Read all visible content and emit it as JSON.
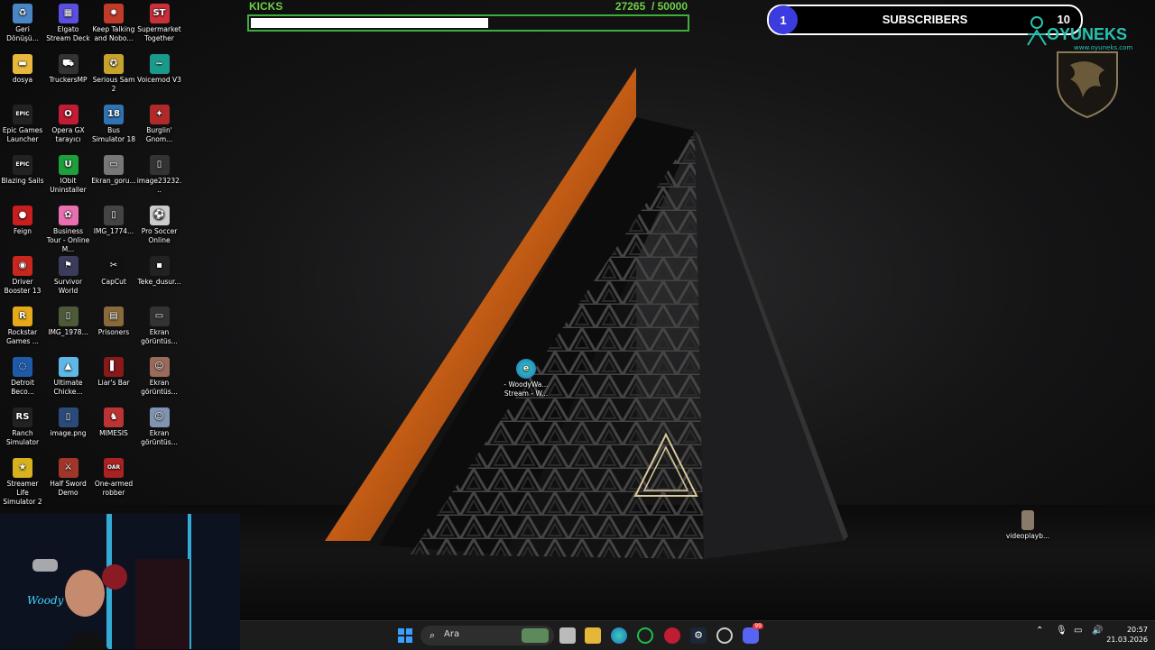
{
  "kicks": {
    "title": "KICKS",
    "current": "27265",
    "goal": "/ 50000",
    "progress": 0.545
  },
  "subscribers": {
    "current": "1",
    "label": "SUBSCRIBERS",
    "goal": "10"
  },
  "brand": {
    "name": "OYUNEKS",
    "url": "www.oyuneks.com"
  },
  "desktop_icons": [
    {
      "label": "Geri Dönüşü...",
      "color": "#4a86c5",
      "glyph": "♻"
    },
    {
      "label": "Elgato Stream Deck",
      "color": "#5b4fe0",
      "glyph": "▦"
    },
    {
      "label": "Keep Talking and Nobo...",
      "color": "#c23b2a",
      "glyph": "✸"
    },
    {
      "label": "Supermarket Together",
      "color": "#c9303a",
      "glyph": "ST"
    },
    {
      "label": "dosya",
      "color": "#e8b83c",
      "glyph": "▬"
    },
    {
      "label": "TruckersMP",
      "color": "#333",
      "glyph": "⛟"
    },
    {
      "label": "Serious Sam 2",
      "color": "#c8a32b",
      "glyph": "✪"
    },
    {
      "label": "Voicemod V3",
      "color": "#1a9a8a",
      "glyph": "~"
    },
    {
      "label": "Epic Games Launcher",
      "color": "#222",
      "glyph": "EPIC"
    },
    {
      "label": "Opera GX tarayıcı",
      "color": "#c01c34",
      "glyph": "O"
    },
    {
      "label": "Bus Simulator 18",
      "color": "#2f74b5",
      "glyph": "18"
    },
    {
      "label": "Burglin' Gnom...",
      "color": "#b02a2a",
      "glyph": "✦"
    },
    {
      "label": "Blazing Sails",
      "color": "#222",
      "glyph": "EPIC"
    },
    {
      "label": "IObit Uninstaller",
      "color": "#1f9e3c",
      "glyph": "U"
    },
    {
      "label": "Ekran_goru...",
      "color": "#777",
      "glyph": "▭"
    },
    {
      "label": "image23232...",
      "color": "#333",
      "glyph": "▯"
    },
    {
      "label": "Feign",
      "color": "#c81e1e",
      "glyph": "●"
    },
    {
      "label": "Business Tour - Online M...",
      "color": "#e86fb0",
      "glyph": "✿"
    },
    {
      "label": "IMG_1774...",
      "color": "#444",
      "glyph": "▯"
    },
    {
      "label": "Pro Soccer Online",
      "color": "#ccc",
      "glyph": "⚽"
    },
    {
      "label": "Driver Booster 13",
      "color": "#c7271f",
      "glyph": "◉"
    },
    {
      "label": "Survivor World",
      "color": "#3b3b5c",
      "glyph": "⚑"
    },
    {
      "label": "CapCut",
      "color": "#111",
      "glyph": "✂"
    },
    {
      "label": "Teke_dusur...",
      "color": "#222",
      "glyph": "▪"
    },
    {
      "label": "Rockstar Games ...",
      "color": "#e6a91a",
      "glyph": "R"
    },
    {
      "label": "IMG_1978...",
      "color": "#4c5a3a",
      "glyph": "▯"
    },
    {
      "label": "Prisoners",
      "color": "#8a6a3a",
      "glyph": "▤"
    },
    {
      "label": "Ekran görüntüs...",
      "color": "#333",
      "glyph": "▭"
    },
    {
      "label": "Detroit Beco...",
      "color": "#1f5aa8",
      "glyph": "◌"
    },
    {
      "label": "Ultimate Chicke...",
      "color": "#5fb7e6",
      "glyph": "▲"
    },
    {
      "label": "Liar's Bar",
      "color": "#8a1a1a",
      "glyph": "▌"
    },
    {
      "label": "Ekran görüntüs...",
      "color": "#9a6a5a",
      "glyph": "☺"
    },
    {
      "label": "Ranch Simulator",
      "color": "#222",
      "glyph": "RS"
    },
    {
      "label": "image.png",
      "color": "#2b4a7a",
      "glyph": "▯"
    },
    {
      "label": "MIMESIS",
      "color": "#b33",
      "glyph": "♞"
    },
    {
      "label": "Ekran görüntüs...",
      "color": "#7f94b0",
      "glyph": "☺"
    },
    {
      "label": "Streamer Life Simulator 2",
      "color": "#d7b21e",
      "glyph": "★"
    },
    {
      "label": "Half Sword Demo",
      "color": "#a0362a",
      "glyph": "⚔"
    },
    {
      "label": "One-armed robber",
      "color": "#a22",
      "glyph": "OAR"
    }
  ],
  "center_icon": {
    "label": "- WoodyWa... Stream - W..."
  },
  "right_icon": {
    "label": "videoplayb..."
  },
  "taskbar": {
    "search_placeholder": "Ara",
    "time": "20:57",
    "date": "21.03.2026",
    "discord_badge": "99"
  }
}
